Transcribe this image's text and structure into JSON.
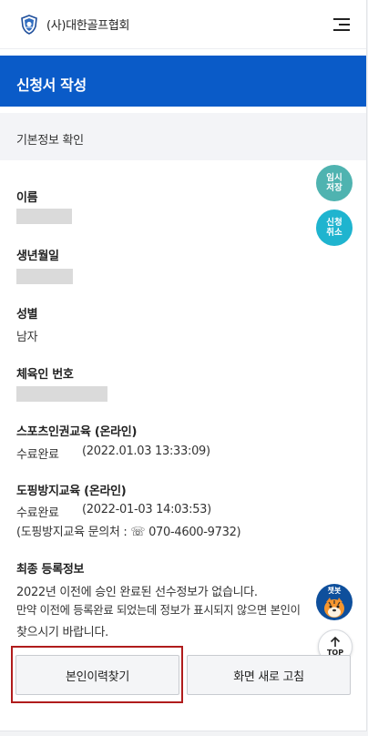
{
  "header": {
    "org_name": "(사)대한골프협회",
    "logo_icon": "kga-shield-logo-icon",
    "menu_icon": "hamburger-menu-icon"
  },
  "banner": {
    "title": "신청서 작성"
  },
  "section": {
    "title": "기본정보 확인"
  },
  "fields": {
    "name": {
      "label": "이름"
    },
    "birth": {
      "label": "생년월일"
    },
    "gender": {
      "label": "성별",
      "value": "남자"
    },
    "sports_id": {
      "label": "체육인 번호"
    },
    "sports_ethics": {
      "label": "스포츠인권교육 (온라인)",
      "status": "수료완료",
      "date": "(2022.01.03 13:33:09)"
    },
    "doping": {
      "label": "도핑방지교육 (온라인)",
      "status": "수료완료",
      "date": "(2022-01-03 14:03:53)",
      "contact": "(도핑방지교육 문의처 : ☏ 070-4600-9732)"
    },
    "final_registration": {
      "label": "최종 등록정보",
      "line1": "2022년 이전에 승인 완료된 선수정보가 없습니다.",
      "line2": "만약 이전에 등록완료 되었는데 정보가 표시되지 않으면 본인이",
      "line3": "찾으시기 바랍니다."
    }
  },
  "floating": {
    "save": {
      "line1": "임시",
      "line2": "저장"
    },
    "cancel": {
      "line1": "신청",
      "line2": "취소"
    },
    "chatbot_label": "챗봇",
    "top_label": "TOP"
  },
  "buttons": {
    "find_history": "본인이력찾기",
    "refresh": "화면 새로 고침"
  },
  "colors": {
    "banner": "#0a5bc8",
    "save_fab": "#4fb3b0",
    "cancel_fab": "#1fb4cf",
    "chatbot": "#0e4f9c",
    "highlight": "#b01c1c"
  }
}
